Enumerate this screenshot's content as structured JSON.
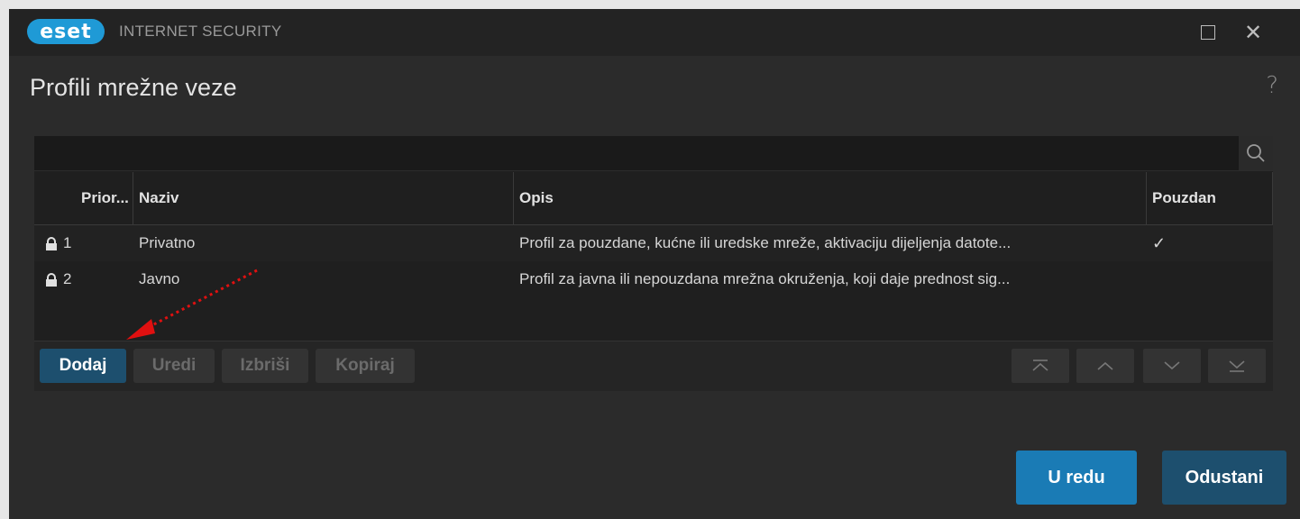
{
  "window": {
    "logo_text": "eset",
    "app_title": "INTERNET SECURITY",
    "maximize_label": "",
    "close_glyph": "✕"
  },
  "page": {
    "title": "Profili mrežne veze",
    "help_glyph": "?"
  },
  "table": {
    "columns": [
      {
        "label": "Prior..."
      },
      {
        "label": "Naziv"
      },
      {
        "label": "Opis"
      },
      {
        "label": "Pouzdan"
      }
    ],
    "rows": [
      {
        "priority": "1",
        "name": "Privatno",
        "description": "Profil za pouzdane, kućne ili uredske mreže, aktivaciju dijeljenja datote...",
        "trusted": "✓",
        "icon": "lock-icon"
      },
      {
        "priority": "2",
        "name": "Javno",
        "description": "Profil za javna ili nepouzdana mrežna okruženja, koji daje prednost sig...",
        "trusted": "",
        "icon": "lock-icon"
      }
    ]
  },
  "toolbar": {
    "add_label": "Dodaj",
    "edit_label": "Uredi",
    "delete_label": "Izbriši",
    "copy_label": "Kopiraj",
    "move_buttons": [
      "move-top-icon",
      "move-up-icon",
      "move-down-icon",
      "move-bottom-icon"
    ]
  },
  "footer": {
    "ok_label": "U redu",
    "cancel_label": "Odustani"
  },
  "colors": {
    "accent": "#1f9ad6",
    "ok_button": "#1a7bb5",
    "cancel_button": "#1d4f6e",
    "annotation_arrow": "#e01010"
  }
}
